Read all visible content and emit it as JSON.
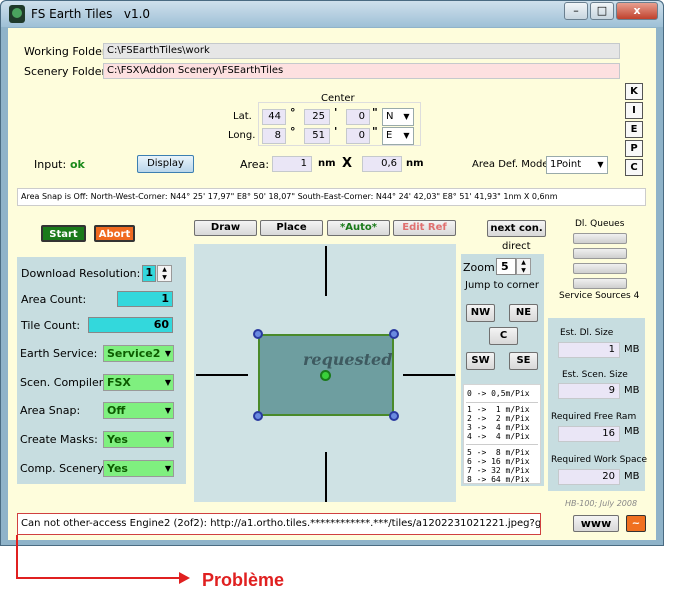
{
  "window": {
    "title": "FS Earth Tiles",
    "version": "v1.0"
  },
  "controls": {
    "minimize": "–",
    "maximize": "□",
    "close": "x"
  },
  "folders": {
    "working_label": "Working Folder:",
    "working_value": "C:\\FSEarthTiles\\work",
    "scenery_label": "Scenery Folder:",
    "scenery_value": "C:\\FSX\\Addon Scenery\\FSEarthTiles"
  },
  "center": {
    "title": "Center",
    "lat_label": "Lat.",
    "lat_deg": "44",
    "lat_min": "25",
    "lat_sec": "0",
    "lat_dir": "N",
    "long_label": "Long.",
    "long_deg": "8",
    "long_min": "51",
    "long_sec": "0",
    "long_dir": "E",
    "deg_sym": "°",
    "min_sym": "'",
    "sec_sym": "\""
  },
  "side_buttons": [
    "K",
    "I",
    "E",
    "P",
    "C"
  ],
  "input": {
    "label": "Input:",
    "status": "ok",
    "display_button": "Display",
    "area_label": "Area:",
    "area_value1": "1",
    "area_unit1": "nm",
    "area_x": "X",
    "area_value2": "0,6",
    "area_unit2": "nm",
    "area_mode_label": "Area Def. Mode:",
    "area_mode_value": "1Point"
  },
  "snap_info": "Area Snap is Off:  North-West-Corner: N44° 25' 17,97\"  E8° 50' 18,07\"   South-East-Corner: N44° 24' 42,03\"  E8° 51' 41,93\"   1nm X 0,6nm",
  "actions": {
    "start": "Start",
    "abort": "Abort"
  },
  "tools": {
    "draw": "Draw",
    "place": "Place",
    "auto": "*Auto*",
    "edit_ref": "Edit Ref",
    "next_con": "next con."
  },
  "settings": {
    "download_res_label": "Download Resolution:",
    "download_res_value": "1",
    "area_count_label": "Area Count:",
    "area_count_value": "1",
    "tile_count_label": "Tile Count:",
    "tile_count_value": "60",
    "earth_service_label": "Earth Service:",
    "earth_service_value": "Service2",
    "compiler_label": "Scen. Compiler:",
    "compiler_value": "FSX",
    "area_snap_label": "Area Snap:",
    "area_snap_value": "Off",
    "masks_label": "Create Masks:",
    "masks_value": "Yes",
    "comp_scenery_label": "Comp. Scenery:",
    "comp_scenery_value": "Yes"
  },
  "canvas": {
    "label": "requested"
  },
  "nav": {
    "direct": "direct",
    "zoom_label": "Zoom",
    "zoom_value": "5",
    "jump_label": "Jump to corner",
    "nw": "NW",
    "ne": "NE",
    "c": "C",
    "sw": "SW",
    "se": "SE"
  },
  "resolution_table": [
    "0 -> 0,5m/Pix",
    "1 ->  1 m/Pix",
    "2 ->  2 m/Pix",
    "3 ->  4 m/Pix",
    "4 ->  4 m/Pix",
    "5 ->  8 m/Pix",
    "6 -> 16 m/Pix",
    "7 -> 32 m/Pix",
    "8 -> 64 m/Pix"
  ],
  "queues": {
    "title": "Dl. Queues",
    "service_sources": "Service Sources 4"
  },
  "estimates": {
    "dl_size_label": "Est. Dl. Size",
    "dl_size_value": "1",
    "dl_size_unit": "MB",
    "scen_size_label": "Est. Scen. Size",
    "scen_size_value": "9",
    "scen_size_unit": "MB",
    "free_ram_label": "Required Free Ram",
    "free_ram_value": "16",
    "free_ram_unit": "MB",
    "work_space_label": "Required Work Space",
    "work_space_value": "20",
    "work_space_unit": "MB"
  },
  "credit": "HB-100;  July 2008",
  "status_message": "Can not other-access Engine2 (2of2): http://a1.ortho.tiles.************.***/tiles/a1202231021221.jpeg?g=172",
  "www_button": "www",
  "tilde_button": "~",
  "annotation": "Problème",
  "colors": {
    "annotation_red": "#e02020",
    "start_green": "#1a7a1a",
    "abort_orange": "#f06a20",
    "area_fill": "#6e9ea0"
  },
  "icons": [
    "app-icon",
    "minimize-icon",
    "maximize-icon",
    "close-icon",
    "arrow-right-icon"
  ]
}
